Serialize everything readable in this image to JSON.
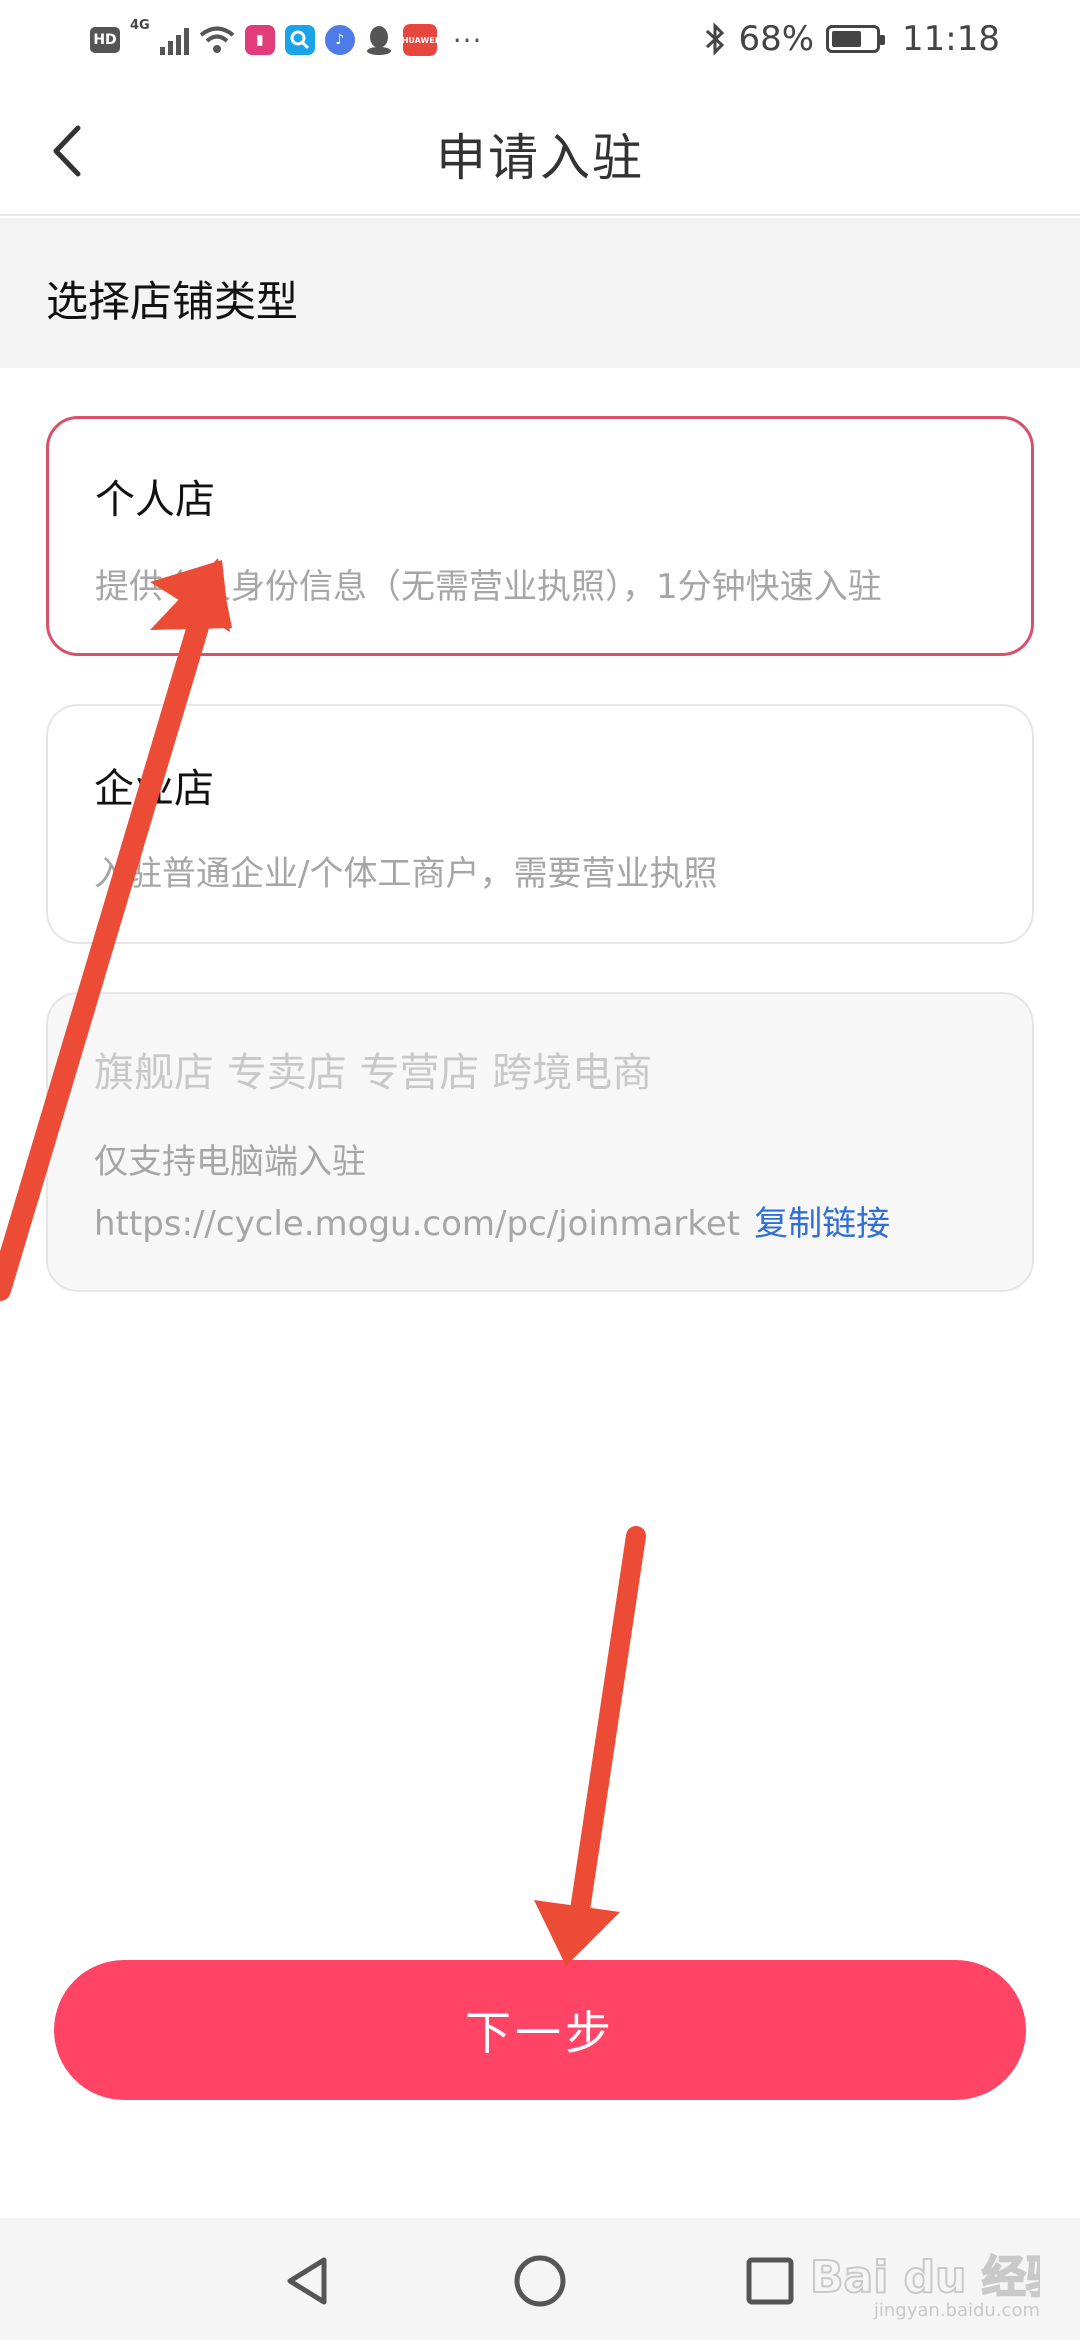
{
  "status_bar": {
    "hd_label": "HD",
    "network": "4G",
    "battery_percent": "68%",
    "battery_level": 0.68,
    "time": "11:18",
    "more": "···",
    "icons": [
      "hd-icon",
      "signal-icon",
      "wifi-icon",
      "app-icon-red",
      "search-app-icon",
      "music-app-icon",
      "qq-icon",
      "huawei-app-icon",
      "bluetooth-icon",
      "battery-icon"
    ]
  },
  "header": {
    "title": "申请入驻",
    "back_icon": "chevron-left-icon"
  },
  "section": {
    "title": "选择店铺类型"
  },
  "cards": {
    "personal": {
      "title": "个人店",
      "desc": "提供个人身份信息（无需营业执照），1分钟快速入驻",
      "selected": true
    },
    "enterprise": {
      "title": "企业店",
      "desc": "入驻普通企业/个体工商户，需要营业执照"
    },
    "flagship": {
      "title": "旗舰店 专卖店 专营店 跨境电商",
      "note": "仅支持电脑端入驻",
      "url": "https://cycle.mogu.com/pc/joinmarket",
      "copy_link": "复制链接"
    }
  },
  "next_button": {
    "label": "下一步"
  },
  "colors": {
    "accent": "#ff4466",
    "selected_border": "#d9506a",
    "link": "#2f6fd6",
    "arrow": "#ec4b36"
  },
  "watermark": {
    "brand": "Bai du 经验",
    "url": "jingyan.baidu.com"
  },
  "nav": {
    "icons": [
      "back-triangle-icon",
      "home-circle-icon",
      "recents-square-icon"
    ]
  }
}
